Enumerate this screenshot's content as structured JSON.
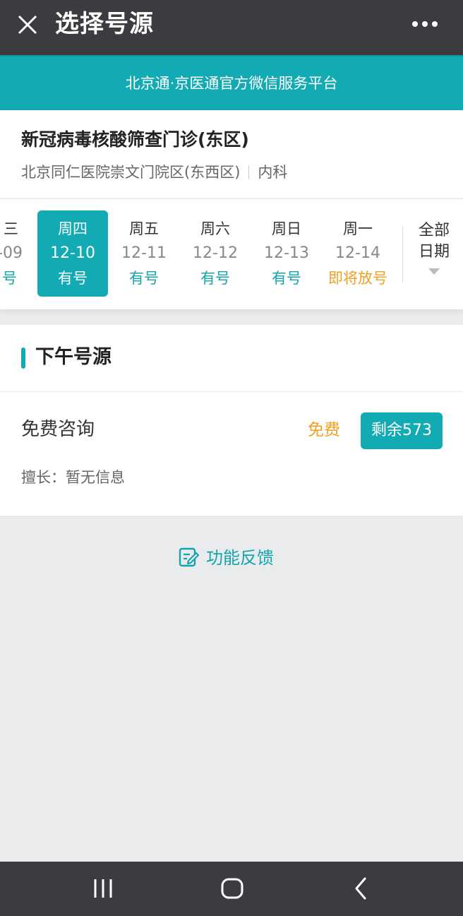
{
  "header": {
    "title": "选择号源"
  },
  "banner": {
    "text": "北京通·京医通官方微信服务平台"
  },
  "clinic": {
    "name": "新冠病毒核酸筛查门诊(东区)",
    "hospital": "北京同仁医院崇文门院区(东西区)",
    "department": "内科"
  },
  "dates": [
    {
      "weekday": "三",
      "date": "-09",
      "status": "号",
      "selected": false
    },
    {
      "weekday": "周四",
      "date": "12-10",
      "status": "有号",
      "selected": true
    },
    {
      "weekday": "周五",
      "date": "12-11",
      "status": "有号",
      "selected": false
    },
    {
      "weekday": "周六",
      "date": "12-12",
      "status": "有号",
      "selected": false
    },
    {
      "weekday": "周日",
      "date": "12-13",
      "status": "有号",
      "selected": false
    },
    {
      "weekday": "周一",
      "date": "12-14",
      "status": "即将放号",
      "selected": false
    }
  ],
  "all_dates": {
    "line1": "全部",
    "line2": "日期"
  },
  "section": {
    "title": "下午号源"
  },
  "slot": {
    "name": "免费咨询",
    "fee": "免费",
    "remaining": "剩余573",
    "specialty": "擅长：暂无信息"
  },
  "feedback": {
    "label": "功能反馈"
  },
  "colors": {
    "accent": "#12aab3",
    "warning": "#f0a020",
    "topbar": "#3a3c3f",
    "background": "#e9ebed"
  },
  "icons": {
    "close": "close-icon",
    "more": "more-icon",
    "dropdown": "triangle-down-icon",
    "feedback": "edit-note-icon",
    "nav_recent": "recent-apps-icon",
    "nav_home": "home-icon",
    "nav_back": "back-icon"
  }
}
